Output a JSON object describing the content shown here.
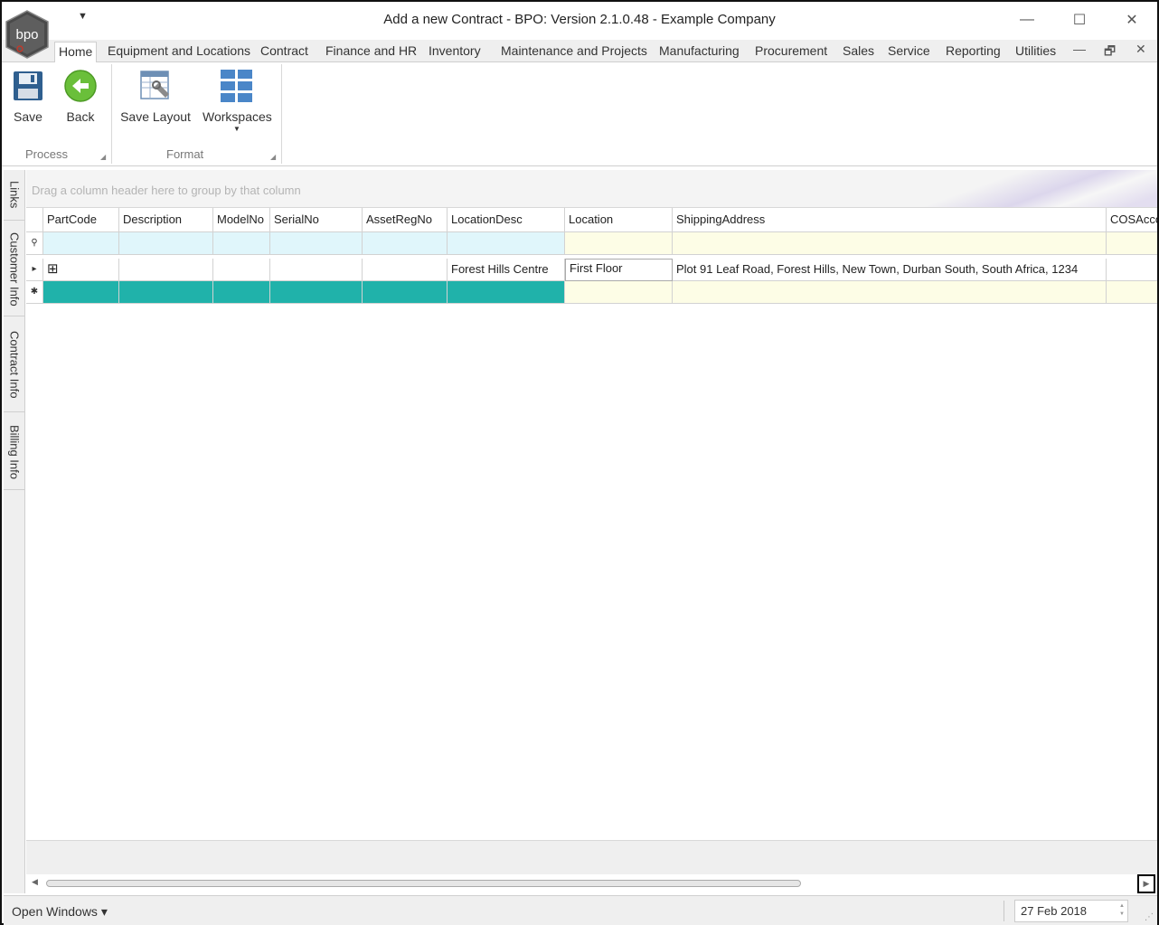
{
  "window": {
    "title": "Add a new Contract - BPO: Version 2.1.0.48 - Example Company",
    "logo_text": "bpo",
    "minimize": "—",
    "maximize": "☐",
    "close": "✕",
    "qat_dropdown": "▼"
  },
  "tabs": [
    {
      "label": "Home",
      "active": true
    },
    {
      "label": "Equipment and Locations"
    },
    {
      "label": "Contract"
    },
    {
      "label": "Finance and HR"
    },
    {
      "label": "Inventory"
    },
    {
      "label": "Maintenance and Projects"
    },
    {
      "label": "Manufacturing"
    },
    {
      "label": "Procurement"
    },
    {
      "label": "Sales"
    },
    {
      "label": "Service"
    },
    {
      "label": "Reporting"
    },
    {
      "label": "Utilities"
    }
  ],
  "mdi": {
    "minimize": "—",
    "restore": "🗗",
    "close": "✕"
  },
  "ribbon": {
    "save": "Save",
    "back": "Back",
    "save_layout": "Save Layout",
    "workspaces": "Workspaces",
    "process_group": "Process",
    "format_group": "Format"
  },
  "side_tabs": [
    "Links",
    "Customer Info",
    "Contract Info",
    "Billing Info"
  ],
  "grid": {
    "group_hint": "Drag a column header here to group by that column",
    "columns": [
      "PartCode",
      "Description",
      "ModelNo",
      "SerialNo",
      "AssetRegNo",
      "LocationDesc",
      "Location",
      "ShippingAddress",
      "COSAcco"
    ],
    "rows": [
      {
        "PartCode": "",
        "Description": "",
        "ModelNo": "",
        "SerialNo": "",
        "AssetRegNo": "",
        "LocationDesc": "Forest Hills Centre",
        "Location": "First Floor",
        "ShippingAddress": "Plot 91 Leaf Road, Forest Hills, New Town, Durban South, South Africa, 1234",
        "COSAcco": ""
      }
    ],
    "expand_glyph": "⊞",
    "row_indicator": "▸",
    "new_row_indicator": "✱",
    "filter_indicator": "⚲"
  },
  "status": {
    "open_windows": "Open Windows ▾",
    "date": "27 Feb 2018"
  },
  "colors": {
    "teal_new_row": "#20b2aa",
    "filter_row_blue": "#e0f6fb",
    "editable_yellow": "#fdfde6",
    "back_icon_green": "#6abf3a",
    "save_icon_blue": "#2f5f8f"
  }
}
